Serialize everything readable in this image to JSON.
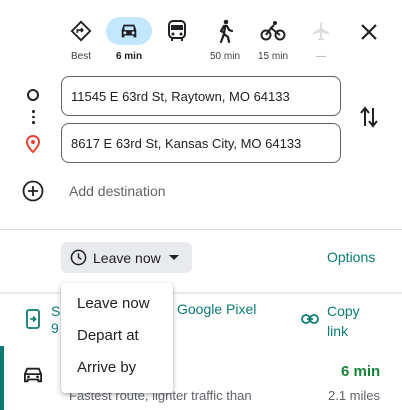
{
  "travel_modes": [
    {
      "id": "best",
      "label": "Best",
      "icon": "best-route-icon",
      "active": false
    },
    {
      "id": "driving",
      "label": "6 min",
      "icon": "car-icon",
      "active": true
    },
    {
      "id": "transit",
      "label": "",
      "icon": "transit-icon",
      "active": false
    },
    {
      "id": "walking",
      "label": "50 min",
      "icon": "walking-icon",
      "active": false
    },
    {
      "id": "cycling",
      "label": "15 min",
      "icon": "bicycle-icon",
      "active": false
    },
    {
      "id": "flights",
      "label": "—",
      "icon": "airplane-icon",
      "active": false
    }
  ],
  "origin": {
    "value": "11545 E 63rd St, Raytown, MO 64133"
  },
  "destination": {
    "value": "8617 E 63rd St, Kansas City, MO 64133"
  },
  "add_destination_label": "Add destination",
  "leave_button_label": "Leave now",
  "options_label": "Options",
  "share": {
    "send_line1": "S",
    "send_line2": "9",
    "send_device_label": "Google Pixel",
    "copy_line1": "Copy",
    "copy_line2": "link"
  },
  "route": {
    "time": "6 min",
    "description": "Fastest route, lighter traffic than",
    "distance": "2.1 miles"
  },
  "leave_menu": {
    "items": [
      "Leave now",
      "Depart at",
      "Arrive by"
    ]
  },
  "colors": {
    "accent": "#0b7a75",
    "active_mode_bg": "#c2e7ff",
    "route_time": "#188038",
    "destination_pin": "#ea4335"
  }
}
